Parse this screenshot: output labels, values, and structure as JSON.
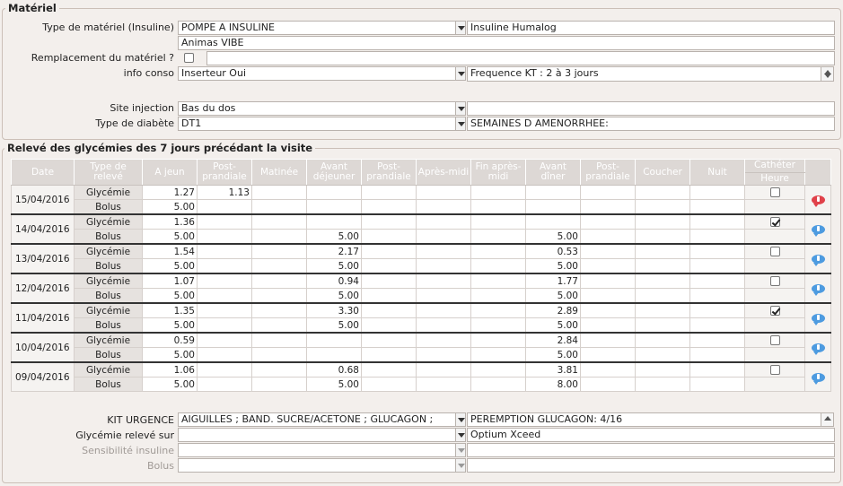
{
  "materiel": {
    "legend": "Matériel",
    "type_label": "Type de matériel (Insuline)",
    "type_value": "POMPE A INSULINE",
    "insuline_value": "Insuline Humalog",
    "model_value": "Animas VIBE",
    "remplacement_label": "Remplacement du matériel ?",
    "remplacement_checked": false,
    "info_conso_label": "info conso",
    "info_conso_value": "Inserteur Oui",
    "frequence_value": "Frequence KT : 2 à 3 jours",
    "site_label": "Site injection",
    "site_value": "Bas du dos",
    "diabete_label": "Type de diabète",
    "diabete_value": "DT1",
    "semaines_value": "SEMAINES D AMENORRHEE:"
  },
  "releve": {
    "legend": "Relevé des glycémies des 7 jours précédant la visite",
    "headers": [
      "Date",
      "Type de relevé",
      "A jeun",
      "Post-prandiale",
      "Matinée",
      "Avant déjeuner",
      "Post-prandiale",
      "Après-midi",
      "Fin après-midi",
      "Avant dîner",
      "Post-prandiale",
      "Coucher",
      "Nuit",
      "Cathéter",
      "Heure"
    ],
    "row_types": [
      "Glycémie",
      "Bolus"
    ],
    "days": [
      {
        "date": "15/04/2016",
        "gly": [
          "1.27",
          "1.13",
          "",
          "",
          "",
          "",
          "",
          "",
          "",
          "",
          ""
        ],
        "bolus": [
          "5.00",
          "",
          "",
          "",
          "",
          "",
          "",
          "",
          "",
          "",
          ""
        ],
        "catheter": false,
        "alert": true
      },
      {
        "date": "14/04/2016",
        "gly": [
          "1.36",
          "",
          "",
          "",
          "",
          "",
          "",
          "",
          "",
          "",
          ""
        ],
        "bolus": [
          "5.00",
          "",
          "",
          "5.00",
          "",
          "",
          "",
          "5.00",
          "",
          "",
          ""
        ],
        "catheter": true,
        "alert": false
      },
      {
        "date": "13/04/2016",
        "gly": [
          "1.54",
          "",
          "",
          "2.17",
          "",
          "",
          "",
          "0.53",
          "",
          "",
          ""
        ],
        "bolus": [
          "5.00",
          "",
          "",
          "5.00",
          "",
          "",
          "",
          "5.00",
          "",
          "",
          ""
        ],
        "catheter": false,
        "alert": false
      },
      {
        "date": "12/04/2016",
        "gly": [
          "1.07",
          "",
          "",
          "0.94",
          "",
          "",
          "",
          "1.77",
          "",
          "",
          ""
        ],
        "bolus": [
          "5.00",
          "",
          "",
          "5.00",
          "",
          "",
          "",
          "5.00",
          "",
          "",
          ""
        ],
        "catheter": false,
        "alert": false
      },
      {
        "date": "11/04/2016",
        "gly": [
          "1.35",
          "",
          "",
          "3.30",
          "",
          "",
          "",
          "2.89",
          "",
          "",
          ""
        ],
        "bolus": [
          "5.00",
          "",
          "",
          "5.00",
          "",
          "",
          "",
          "5.00",
          "",
          "",
          ""
        ],
        "catheter": true,
        "alert": false
      },
      {
        "date": "10/04/2016",
        "gly": [
          "0.59",
          "",
          "",
          "",
          "",
          "",
          "",
          "2.84",
          "",
          "",
          ""
        ],
        "bolus": [
          "5.00",
          "",
          "",
          "",
          "",
          "",
          "",
          "5.00",
          "",
          "",
          ""
        ],
        "catheter": false,
        "alert": false
      },
      {
        "date": "09/04/2016",
        "gly": [
          "1.06",
          "",
          "",
          "0.68",
          "",
          "",
          "",
          "3.81",
          "",
          "",
          ""
        ],
        "bolus": [
          "5.00",
          "",
          "",
          "5.00",
          "",
          "",
          "",
          "8.00",
          "",
          "",
          ""
        ],
        "catheter": false,
        "alert": false
      }
    ]
  },
  "footer": {
    "kit_label": "KIT URGENCE",
    "kit_value": "AIGUILLES ; BAND. SUCRE/ACETONE ; GLUCAGON ;",
    "peremption_value": "PEREMPTION GLUCAGON: 4/16",
    "releve_sur_label": "Glycémie relevé sur",
    "releve_sur_value": "",
    "optium_value": "Optium Xceed",
    "sensibilite_label": "Sensibilité insuline",
    "bolus_label": "Bolus"
  },
  "colors": {
    "alert_icon": "#e0414a",
    "info_icon": "#4d9be0",
    "header_bg": "#ddd8d5"
  },
  "icons": {
    "alert": "red-comment-icon",
    "info": "blue-comment-icon"
  }
}
